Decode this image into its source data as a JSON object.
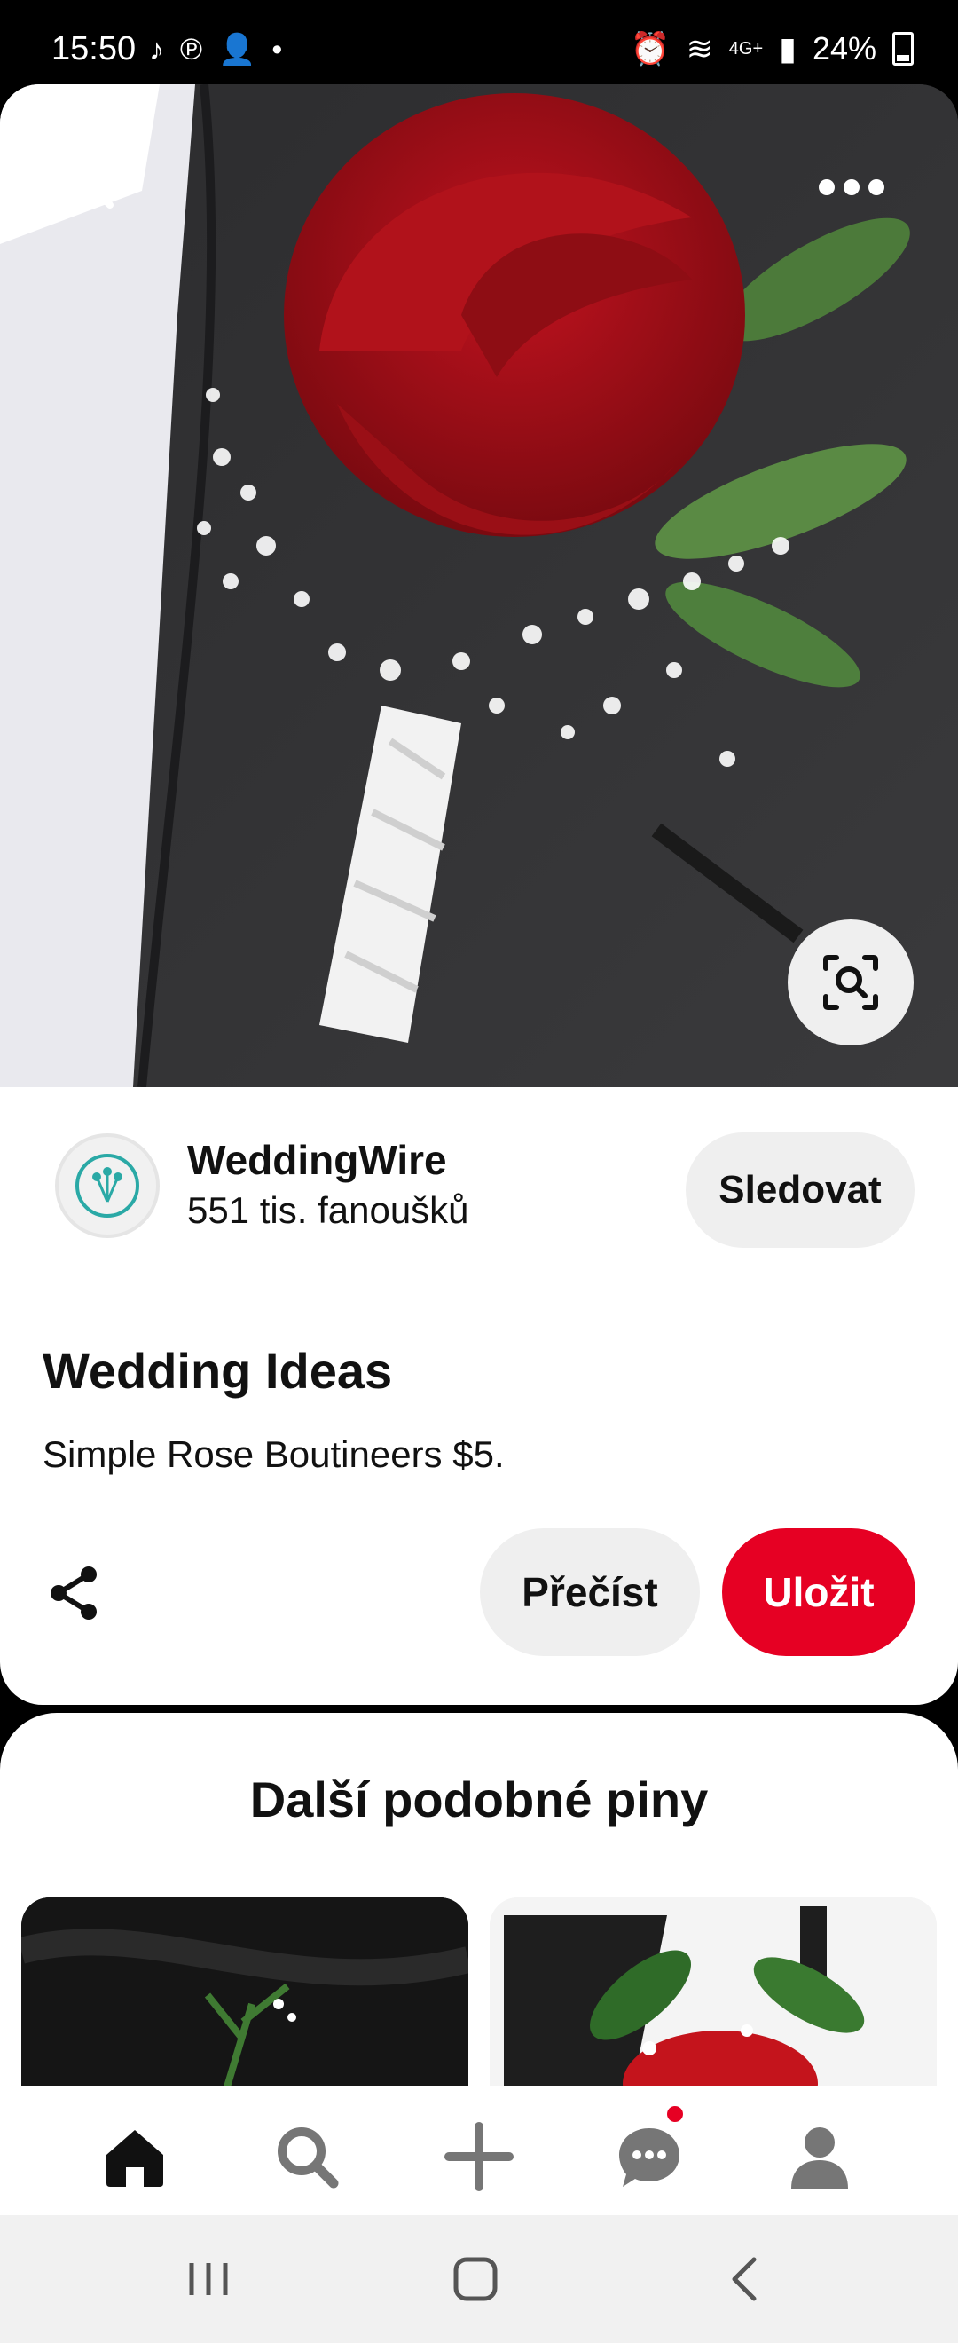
{
  "status_bar": {
    "time": "15:50",
    "battery": "24%",
    "network": "4G+"
  },
  "pin": {
    "creator_name": "WeddingWire",
    "creator_followers": "551 tis. fanoušků",
    "follow_label": "Sledovat",
    "title": "Wedding Ideas",
    "description": "Simple Rose Boutineers $5.",
    "read_label": "Přečíst",
    "save_label": "Uložit"
  },
  "related": {
    "title": "Další podobné piny"
  },
  "icons": {
    "back": "back-chevron-icon",
    "more": "more-dots-icon",
    "visual_search": "visual-search-icon",
    "share": "share-icon",
    "home": "home-icon",
    "search": "search-icon",
    "create": "plus-icon",
    "messages": "chat-icon",
    "profile": "profile-icon"
  },
  "colors": {
    "accent": "#e60023",
    "button_gray": "#efefef",
    "avatar_teal": "#2aa9a6"
  }
}
